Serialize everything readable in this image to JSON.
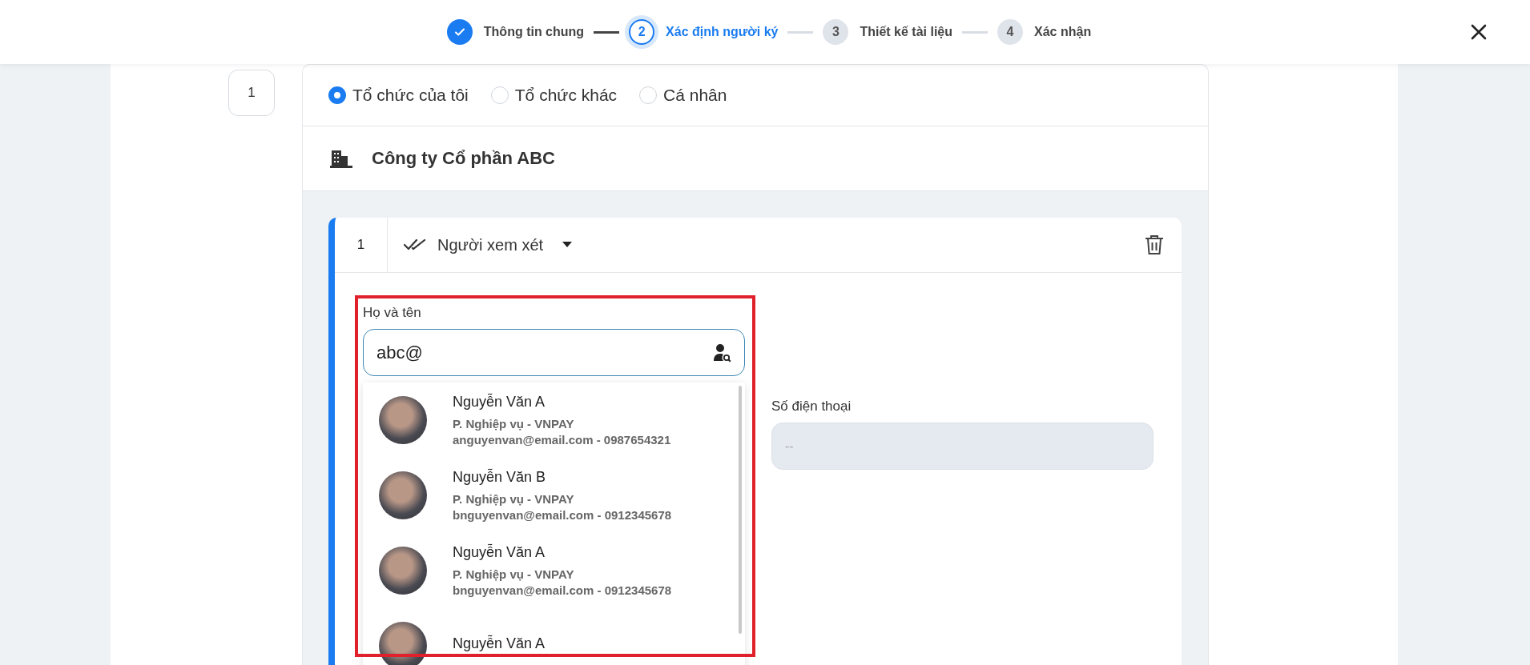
{
  "stepper": [
    {
      "label": "Thông tin chung",
      "completed": true,
      "selected": false
    },
    {
      "number": "2",
      "label": "Xác định người ký",
      "completed": false,
      "selected": true
    },
    {
      "number": "3",
      "label": "Thiết kế tài liệu",
      "completed": false,
      "selected": false
    },
    {
      "number": "4",
      "label": "Xác nhận",
      "completed": false,
      "selected": false
    }
  ],
  "party": {
    "number": "1",
    "radio_options": [
      {
        "label": "Tổ chức của tôi",
        "selected": true
      },
      {
        "label": "Tổ chức khác",
        "selected": false
      },
      {
        "label": "Cá nhân",
        "selected": false
      }
    ],
    "organization": "Công ty Cổ phần ABC",
    "signer": {
      "number": "1",
      "role": "Người xem xét",
      "name_field": {
        "label": "Họ và tên",
        "value": "abc@"
      },
      "suggestions": [
        {
          "name": "Nguyễn Văn A",
          "department": "P. Nghiệp vụ - VNPAY",
          "contact": "anguyenvan@email.com - 0987654321"
        },
        {
          "name": "Nguyễn Văn B",
          "department": "P. Nghiệp vụ - VNPAY",
          "contact": "bnguyenvan@email.com - 0912345678"
        },
        {
          "name": "Nguyễn Văn A",
          "department": "P. Nghiệp vụ - VNPAY",
          "contact": "bnguyenvan@email.com - 0912345678"
        },
        {
          "name": "Nguyễn Văn A"
        }
      ],
      "phone_field": {
        "label": "Số điện thoại",
        "placeholder": "--"
      }
    }
  }
}
